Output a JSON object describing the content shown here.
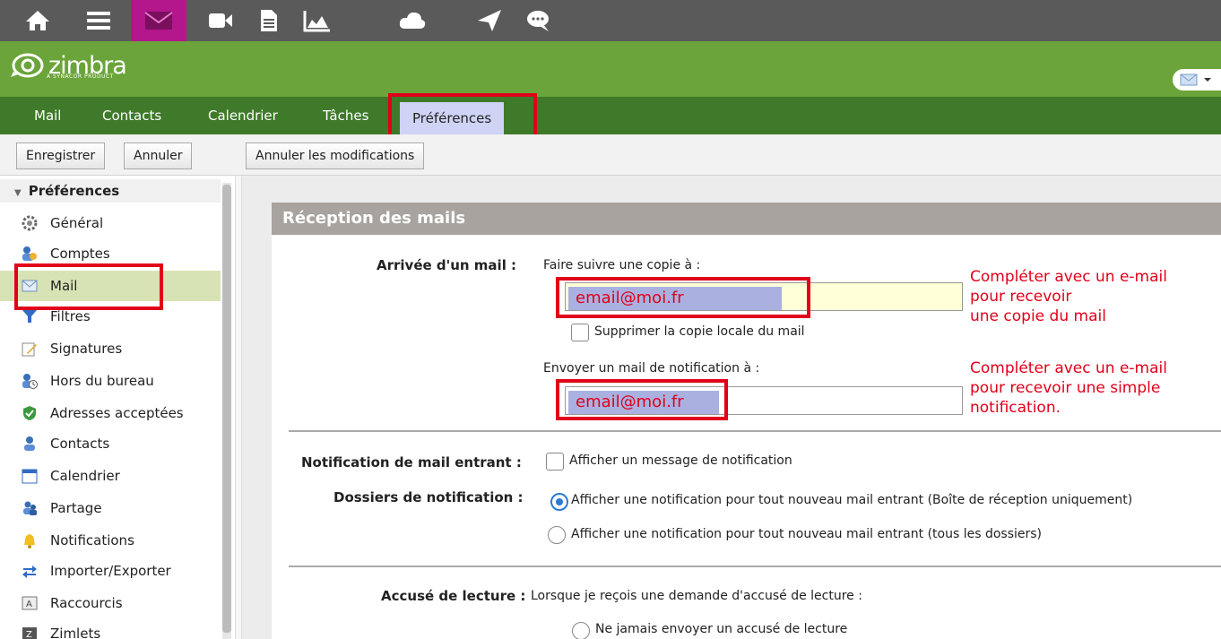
{
  "appbar": {
    "icons": [
      "home-icon",
      "menu-icon",
      "mail-icon",
      "video-icon",
      "document-icon",
      "chart-icon",
      "cloud-icon",
      "send-icon",
      "chat-icon"
    ],
    "active_color": "#b3178b"
  },
  "header": {
    "brand": "zimbra",
    "brand_sub": "A SYNACOR PRODUCT",
    "background": "#6ba43a"
  },
  "tabs": [
    "Mail",
    "Contacts",
    "Calendrier",
    "Tâches",
    "Préférences"
  ],
  "active_tab": "Préférences",
  "toolbar": {
    "save": "Enregistrer",
    "cancel": "Annuler",
    "revert": "Annuler les modifications"
  },
  "sidebar": {
    "title": "Préférences",
    "selected": "Mail",
    "items": [
      {
        "label": "Général",
        "icon": "gear-icon"
      },
      {
        "label": "Comptes",
        "icon": "accounts-icon"
      },
      {
        "label": "Mail",
        "icon": "mail-icon"
      },
      {
        "label": "Filtres",
        "icon": "filter-icon"
      },
      {
        "label": "Signatures",
        "icon": "signature-icon"
      },
      {
        "label": "Hors du bureau",
        "icon": "out-of-office-icon"
      },
      {
        "label": "Adresses acceptées",
        "icon": "shield-icon"
      },
      {
        "label": "Contacts",
        "icon": "contact-icon"
      },
      {
        "label": "Calendrier",
        "icon": "calendar-icon"
      },
      {
        "label": "Partage",
        "icon": "share-icon"
      },
      {
        "label": "Notifications",
        "icon": "bell-icon"
      },
      {
        "label": "Importer/Exporter",
        "icon": "import-export-icon"
      },
      {
        "label": "Raccourcis",
        "icon": "keyboard-icon"
      },
      {
        "label": "Zimlets",
        "icon": "zimlet-icon"
      }
    ]
  },
  "section": {
    "title": "Réception des mails",
    "arrival": {
      "label": "Arrivée d'un mail :",
      "forward_label": "Faire suivre une copie à :",
      "forward_value": "email@moi.fr",
      "forward_note": [
        "Compléter avec un e-mail",
        "pour recevoir",
        "une copie du mail"
      ],
      "delete_local": "Supprimer la copie locale du mail",
      "notify_label": "Envoyer un mail de notification à :",
      "notify_value": "email@moi.fr",
      "notify_note": [
        "Compléter avec un e-mail",
        "pour recevoir une simple",
        "notification."
      ]
    },
    "incoming": {
      "label": "Notification de mail entrant :",
      "option": "Afficher un message de notification"
    },
    "folders": {
      "label": "Dossiers de notification :",
      "options": [
        "Afficher une notification pour tout nouveau mail entrant (Boîte de réception uniquement)",
        "Afficher une notification pour tout nouveau mail entrant (tous les dossiers)"
      ],
      "selected": 0
    },
    "read_receipt": {
      "label": "Accusé de lecture :",
      "question": "Lorsque je reçois une demande d'accusé de lecture :",
      "option": "Ne jamais envoyer un accusé de lecture"
    }
  },
  "colors": {
    "annotation": "#e1001a",
    "selection": "#aab1e0",
    "tab_bar": "#3f7a2a"
  }
}
